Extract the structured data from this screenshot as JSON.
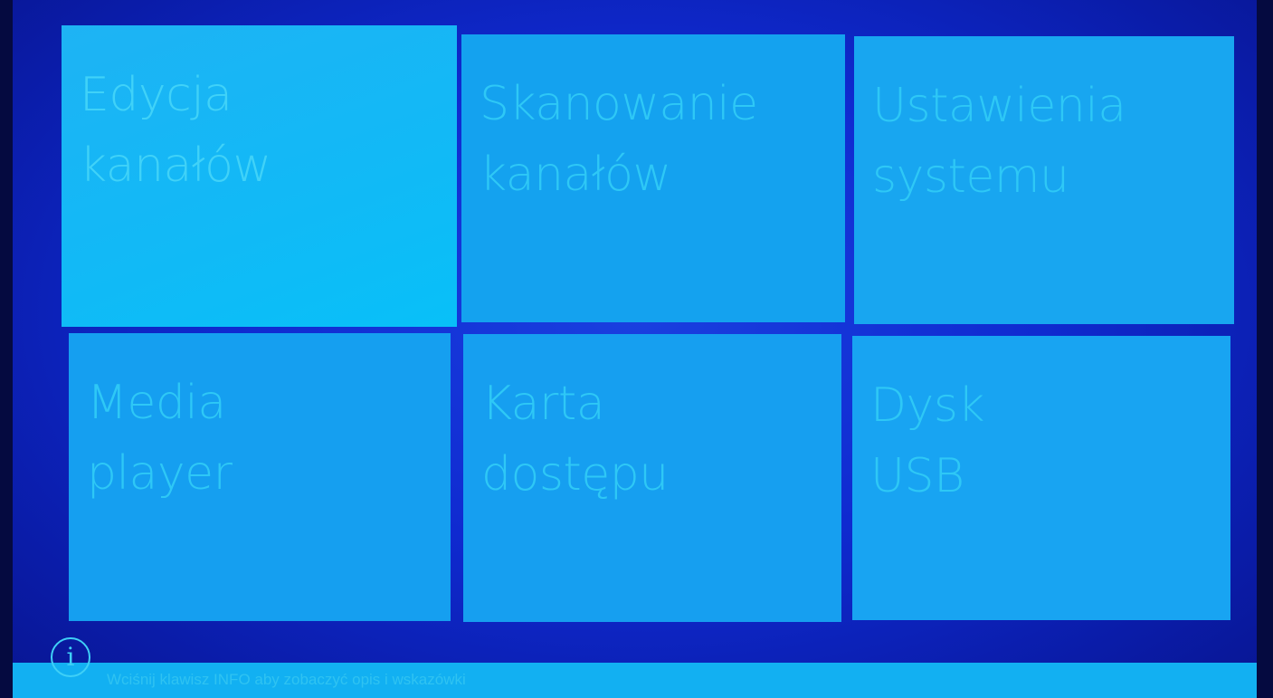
{
  "tiles": [
    {
      "id": "edycja",
      "label": "Edycja\nkanałów"
    },
    {
      "id": "skanowanie",
      "label": "Skanowanie\nkanałów"
    },
    {
      "id": "ustawienia",
      "label": "Ustawienia\nsystemu"
    },
    {
      "id": "media",
      "label": "Media\nplayer"
    },
    {
      "id": "karta",
      "label": "Karta\ndostępu"
    },
    {
      "id": "usb",
      "label": "Dysk\nUSB"
    }
  ],
  "infobar": {
    "icon": "info-icon",
    "icon_glyph": "i",
    "text": "Wciśnij klawisz INFO aby zobaczyć opis i wskazówki"
  },
  "colors": {
    "background": "#0f2ad0",
    "tile": "#18a4f2",
    "tile_text": "#2ec8f6"
  }
}
